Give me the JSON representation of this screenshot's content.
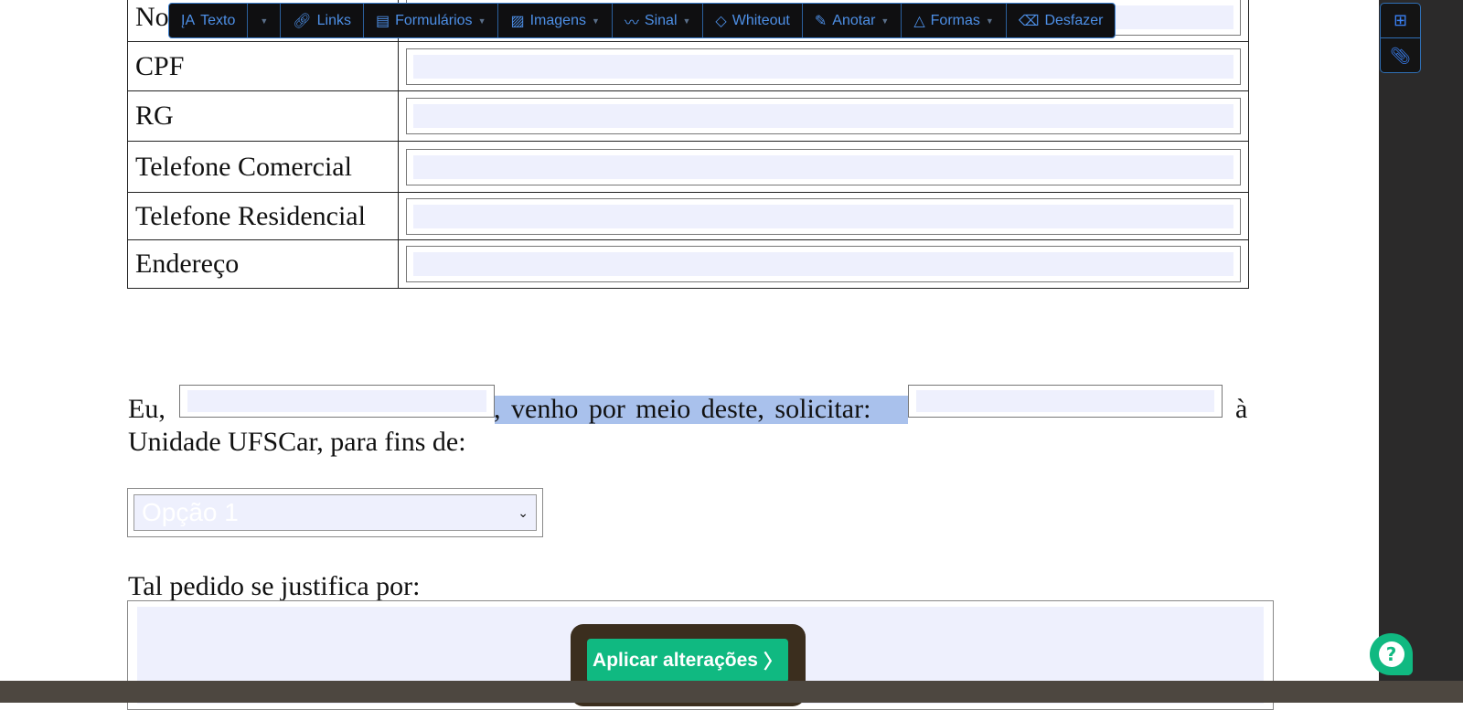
{
  "toolbar": {
    "items": [
      {
        "label": "Texto",
        "icon": "text-icon"
      },
      {
        "label": "Links",
        "icon": "link-icon"
      },
      {
        "label": "Formulários",
        "icon": "form-icon"
      },
      {
        "label": "Imagens",
        "icon": "image-icon"
      },
      {
        "label": "Sinal",
        "icon": "signature-icon"
      },
      {
        "label": "Whiteout",
        "icon": "eraser-icon"
      },
      {
        "label": "Anotar",
        "icon": "pen-icon"
      },
      {
        "label": "Formas",
        "icon": "shapes-icon"
      },
      {
        "label": "Desfazer",
        "icon": "undo-icon"
      }
    ]
  },
  "table": {
    "rows": [
      "No",
      "CPF",
      "RG",
      "Telefone Comercial",
      "Telefone Residencial",
      "Endereço"
    ]
  },
  "paragraph": {
    "eu": "Eu,",
    "middle": ", venho por meio deste, solicitar:",
    "a": "à",
    "line2": "Unidade UFSCar, para fins de:"
  },
  "select": {
    "value": "Opção 1"
  },
  "justify_label": "Tal pedido se justifica por:",
  "apply_label": "Aplicar alterações",
  "help_label": "?"
}
